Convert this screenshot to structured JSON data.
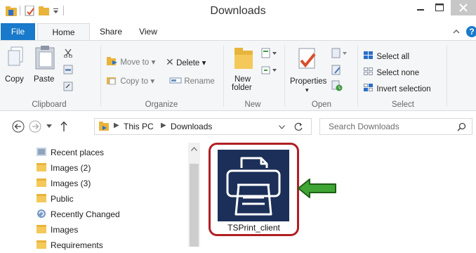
{
  "window": {
    "title": "Downloads"
  },
  "tabs": {
    "file": "File",
    "home": "Home",
    "share": "Share",
    "view": "View"
  },
  "ribbon": {
    "clipboard": {
      "copy": "Copy",
      "paste": "Paste",
      "group": "Clipboard"
    },
    "organize": {
      "move_to": "Move to",
      "copy_to": "Copy to",
      "delete": "Delete",
      "rename": "Rename",
      "group": "Organize"
    },
    "new": {
      "new_folder_line1": "New",
      "new_folder_line2": "folder",
      "group": "New"
    },
    "open": {
      "properties": "Properties",
      "group": "Open"
    },
    "select": {
      "select_all": "Select all",
      "select_none": "Select none",
      "invert": "Invert selection",
      "group": "Select"
    }
  },
  "address": {
    "this_pc": "This PC",
    "downloads": "Downloads"
  },
  "search": {
    "placeholder": "Search Downloads"
  },
  "nav": [
    {
      "label": "Recent places"
    },
    {
      "label": "Images (2)"
    },
    {
      "label": "Images (3)"
    },
    {
      "label": "Public"
    },
    {
      "label": "Recently Changed"
    },
    {
      "label": "Images"
    },
    {
      "label": "Requirements"
    }
  ],
  "files": [
    {
      "name": "TSPrint_client"
    }
  ],
  "colors": {
    "file_tab": "#1979ca",
    "highlight_border": "#b01f24",
    "arrow": "#3fa535",
    "icon_bg": "#1b2f58"
  }
}
